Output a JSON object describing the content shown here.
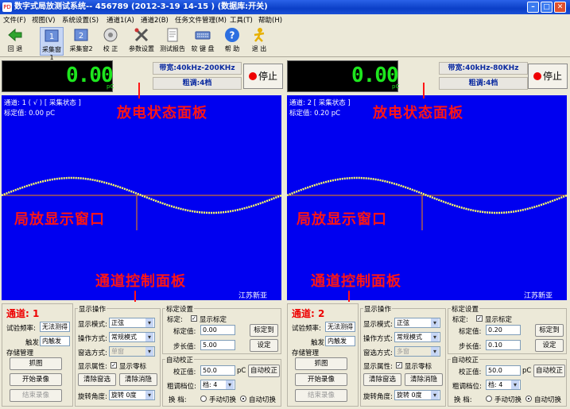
{
  "window": {
    "title": "数字式局放测试系统--  456789 (2012-3-19   14-15 )  (数据库:开关)",
    "app_icon": "PD"
  },
  "menu": [
    "文件(F)",
    "视图(V)",
    "系统设置(S)",
    "通道1(A)",
    "通道2(B)",
    "任务文件管理(M)",
    "工具(T)",
    "帮助(H)"
  ],
  "toolbar": [
    {
      "label": "回 退",
      "icon": "back-arrow-icon"
    },
    {
      "label": "采集窗1",
      "icon": "window1-icon",
      "active": true
    },
    {
      "label": "采集窗2",
      "icon": "window2-icon"
    },
    {
      "label": "校 正",
      "icon": "calibrate-icon"
    },
    {
      "label": "参数设置",
      "icon": "tools-icon"
    },
    {
      "label": "测试报告",
      "icon": "report-icon"
    },
    {
      "label": "软 键 盘",
      "icon": "keyboard-icon"
    },
    {
      "label": "帮 助",
      "icon": "help-icon"
    },
    {
      "label": "退 出",
      "icon": "exit-icon"
    }
  ],
  "channels": [
    {
      "lcd_value": "0.00",
      "lcd_unit": "pC",
      "bandwidth": "带宽:40kHz-200KHz",
      "coarse": "粗调:4档",
      "stop_label": "停止",
      "status_line": "通道: 1 ( √ ) [ 采集状态 ]",
      "calib_line": "标定值: 0.00 pC",
      "overlay_status": "放电状态面板",
      "overlay_window": "局放显示窗口",
      "overlay_control": "通道控制面板",
      "corner_text": "江苏新亚",
      "channel_label": "通道: 1",
      "test_freq_label": "试验频率:",
      "test_freq_value": "无法测得",
      "trigger_label": "触发:",
      "trigger_value": "内触发",
      "storage_title": "存储管理",
      "capture_btn": "抓图",
      "start_rec_btn": "开始录像",
      "end_rec_btn": "结束录像",
      "display_title": "显示操作",
      "display_mode_label": "显示模式:",
      "display_mode_value": "正弦",
      "operation_label": "操作方式:",
      "operation_value": "常规模式",
      "window_mode_label": "窗选方式:",
      "window_mode_value": "单窗",
      "display_prop_label": "显示属性:",
      "show_zero_label": "显示零标",
      "clear_window_btn": "清除窗选",
      "clear_cancel_btn": "清除消隐",
      "rotate_label": "旋转角度:",
      "rotate_value": "旋转 0度",
      "calib_title": "标定设置",
      "calib_label": "标定:",
      "show_calib_label": "显示标定",
      "calib_value_label": "标定值:",
      "calib_value": "0.00",
      "calib_to_btn": "标定到",
      "step_label": "步长值:",
      "step_value": "5.00",
      "set_btn": "设定",
      "auto_title": "自动校正",
      "correct_label": "校正值:",
      "correct_value": "50.0",
      "correct_unit": "pC",
      "auto_correct_btn": "自动校正",
      "coarse_pos_label": "粗调档位:",
      "coarse_pos_value": "档: 4",
      "switch_label": "换    档:",
      "manual_switch": "手动切换",
      "auto_switch": "自动切换"
    },
    {
      "lcd_value": "0.00",
      "lcd_unit": "pC",
      "bandwidth": "带宽:40kHz-80KHz",
      "coarse": "粗调:4档",
      "stop_label": "停止",
      "status_line": "通道: 2 [ 采集状态 ]",
      "calib_line": "标定值: 0.20 pC",
      "overlay_status": "放电状态面板",
      "overlay_window": "局放显示窗口",
      "overlay_control": "通道控制面板",
      "corner_text": "江苏新亚",
      "channel_label": "通道: 2",
      "test_freq_label": "试验频率:",
      "test_freq_value": "无法测得",
      "trigger_label": "触发:",
      "trigger_value": "内触发",
      "storage_title": "存储管理",
      "capture_btn": "抓图",
      "start_rec_btn": "开始录像",
      "end_rec_btn": "结束录像",
      "display_title": "显示操作",
      "display_mode_label": "显示模式:",
      "display_mode_value": "正弦",
      "operation_label": "操作方式:",
      "operation_value": "常规模式",
      "window_mode_label": "窗选方式:",
      "window_mode_value": "多窗",
      "display_prop_label": "显示属性:",
      "show_zero_label": "显示零标",
      "clear_window_btn": "清除窗选",
      "clear_cancel_btn": "清除消隐",
      "rotate_label": "旋转角度:",
      "rotate_value": "旋转 0度",
      "calib_title": "标定设置",
      "calib_label": "标定:",
      "show_calib_label": "显示标定",
      "calib_value_label": "标定值:",
      "calib_value": "0.20",
      "calib_to_btn": "标定到",
      "step_label": "步长值:",
      "step_value": "0.10",
      "set_btn": "设定",
      "auto_title": "自动校正",
      "correct_label": "校正值:",
      "correct_value": "50.0",
      "correct_unit": "pC",
      "auto_correct_btn": "自动校正",
      "coarse_pos_label": "粗调档位:",
      "coarse_pos_value": "档: 4",
      "switch_label": "换    档:",
      "manual_switch": "手动切换",
      "auto_switch": "自动切换"
    }
  ],
  "colors": {
    "plot_bg": "#0000f0",
    "sine": "#ffff66",
    "zero_line": "#ff8c00",
    "annotation": "#ff1515"
  }
}
